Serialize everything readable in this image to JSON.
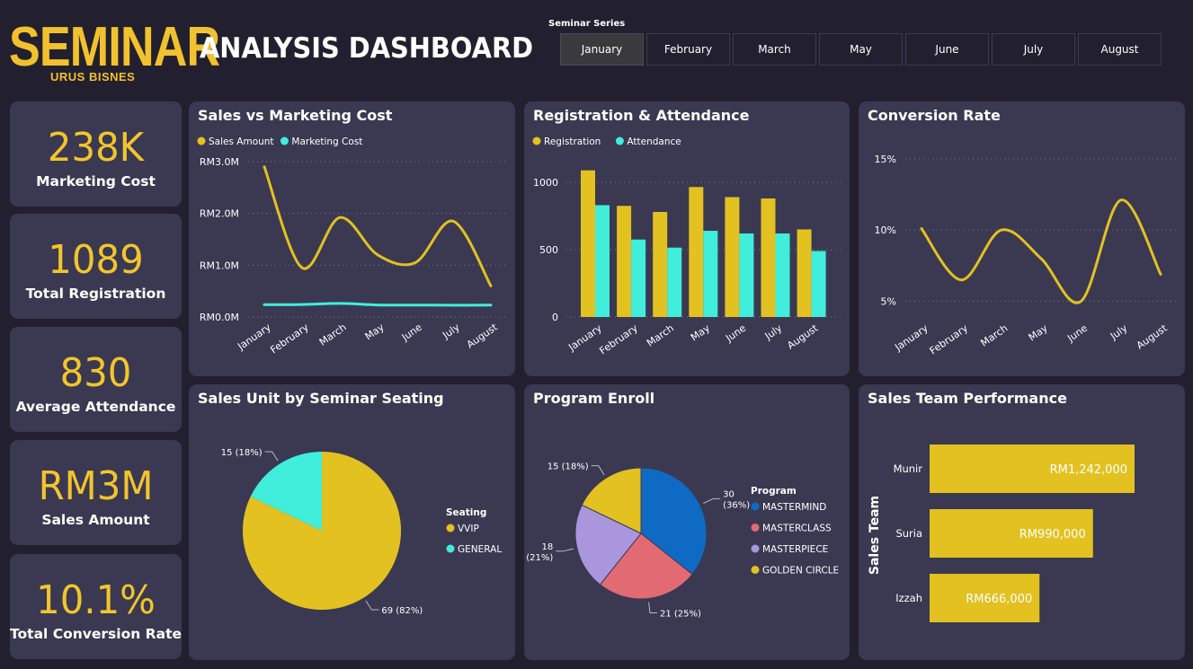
{
  "header": {
    "logo_main": "SEMINAR",
    "logo_sub": "URUS BISNES",
    "title": "ANALYSIS DASHBOARD"
  },
  "slicer": {
    "title": "Seminar Series",
    "options": [
      "January",
      "February",
      "March",
      "May",
      "June",
      "July",
      "August"
    ],
    "selected": "January"
  },
  "kpis": [
    {
      "value": "238K",
      "label": "Marketing Cost"
    },
    {
      "value": "1089",
      "label": "Total Registration"
    },
    {
      "value": "830",
      "label": "Average Attendance"
    },
    {
      "value": "RM3M",
      "label": "Sales Amount"
    },
    {
      "value": "10.1%",
      "label": "Total Conversion Rate"
    }
  ],
  "panels": {
    "sales_marketing": "Sales vs Marketing Cost",
    "registration": "Registration & Attendance",
    "conversion": "Conversion Rate",
    "seating": "Sales Unit by Seminar Seating",
    "program": "Program Enroll",
    "team": "Sales Team Performance"
  },
  "colors": {
    "yellow": "#e2c121",
    "cyan": "#41eedb",
    "blue": "#0f6ac4",
    "red": "#e16a73",
    "purple": "#a996dc",
    "panel": "#3a3951",
    "background": "#22202f"
  },
  "chart_data": [
    {
      "id": "sales_vs_marketing",
      "type": "line",
      "title": "Sales vs Marketing Cost",
      "x": [
        "January",
        "February",
        "March",
        "May",
        "June",
        "July",
        "August"
      ],
      "series": [
        {
          "name": "Sales Amount",
          "color": "#e2c121",
          "values": [
            2900000,
            950000,
            1920000,
            1200000,
            1050000,
            1850000,
            600000
          ]
        },
        {
          "name": "Marketing Cost",
          "color": "#41eedb",
          "values": [
            238000,
            240000,
            262000,
            232000,
            230000,
            228000,
            230000
          ]
        }
      ],
      "yticks": [
        "RM0.0M",
        "RM1.0M",
        "RM2.0M",
        "RM3.0M"
      ],
      "ylim": [
        0,
        3000000
      ],
      "legend": "top-left",
      "grid": true
    },
    {
      "id": "registration_attendance",
      "type": "bar",
      "title": "Registration & Attendance",
      "categories": [
        "January",
        "February",
        "March",
        "May",
        "June",
        "July",
        "August"
      ],
      "series": [
        {
          "name": "Registration",
          "color": "#e2c121",
          "values": [
            1089,
            825,
            780,
            965,
            890,
            880,
            650
          ]
        },
        {
          "name": "Attendance",
          "color": "#41eedb",
          "values": [
            830,
            575,
            515,
            640,
            620,
            620,
            490
          ]
        }
      ],
      "yticks": [
        "0",
        "500",
        "1000"
      ],
      "ylim": [
        0,
        1200
      ],
      "legend": "top-left",
      "grid": true
    },
    {
      "id": "conversion_rate",
      "type": "line",
      "title": "Conversion Rate",
      "x": [
        "January",
        "February",
        "March",
        "May",
        "June",
        "July",
        "August"
      ],
      "series": [
        {
          "name": "Conversion Rate",
          "color": "#e2c121",
          "values": [
            10.1,
            6.5,
            10.0,
            8.0,
            5.0,
            12.1,
            6.9
          ]
        }
      ],
      "yticks": [
        "5%",
        "10%",
        "15%"
      ],
      "ylim": [
        3.9,
        16.5
      ],
      "grid": true
    },
    {
      "id": "seating",
      "type": "pie",
      "title": "Sales Unit by Seminar Seating",
      "legend_title": "Seating",
      "slices": [
        {
          "label": "VVIP",
          "value": 69,
          "text": "69 (82%)",
          "color": "#e2c121"
        },
        {
          "label": "GENERAL",
          "value": 15,
          "text": "15 (18%)",
          "color": "#41eedb"
        }
      ]
    },
    {
      "id": "program",
      "type": "pie",
      "title": "Program Enroll",
      "legend_title": "Program",
      "slices": [
        {
          "label": "MASTERMIND",
          "value": 30,
          "text": "30\n(36%)",
          "color": "#0f6ac4"
        },
        {
          "label": "MASTERCLASS",
          "value": 21,
          "text": "21 (25%)",
          "color": "#e16a73"
        },
        {
          "label": "MASTERPIECE",
          "value": 18,
          "text": "18\n(21%)",
          "color": "#a996dc"
        },
        {
          "label": "GOLDEN CIRCLE",
          "value": 15,
          "text": "15 (18%)",
          "color": "#e2c121"
        }
      ]
    },
    {
      "id": "sales_team",
      "type": "bar",
      "orientation": "horizontal",
      "title": "Sales Team Performance",
      "ylabel": "Sales Team",
      "categories": [
        "Munir",
        "Suria",
        "Izzah"
      ],
      "values": [
        1242000,
        990000,
        666000
      ],
      "labels": [
        "RM1,242,000",
        "RM990,000",
        "RM666,000"
      ],
      "color": "#e2c121",
      "xlim": [
        0,
        1242000
      ]
    }
  ]
}
